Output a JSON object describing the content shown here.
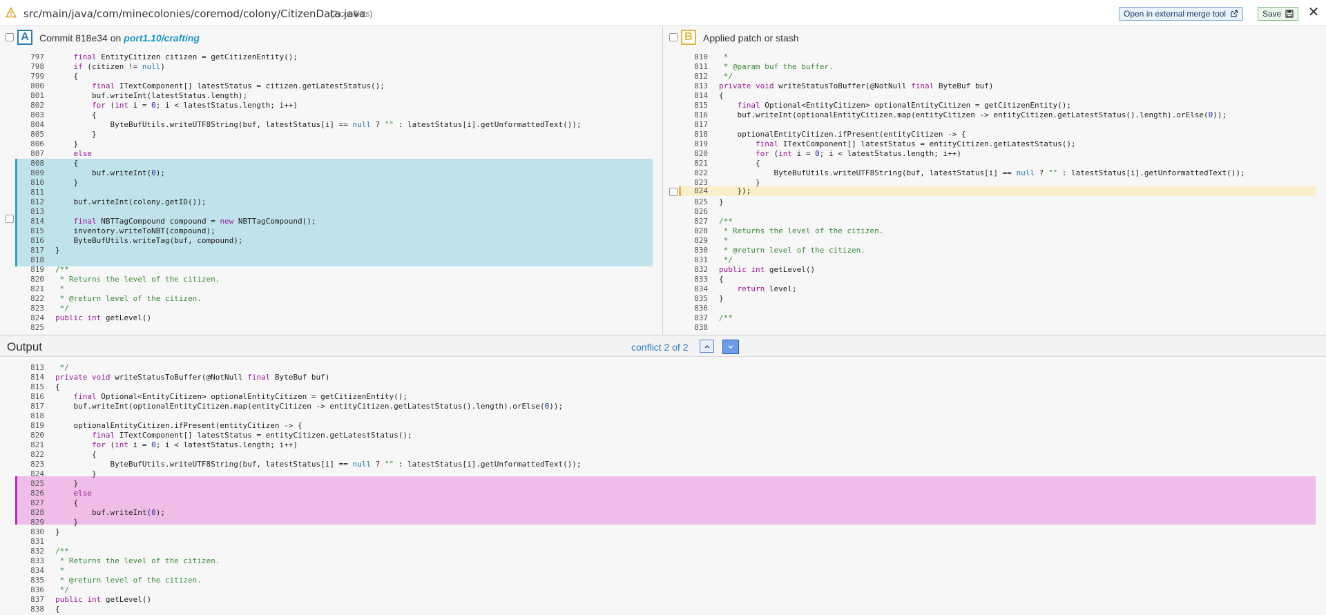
{
  "topbar": {
    "file_path": "src/main/java/com/minecolonies/coremod/colony/CitizenData.java",
    "conflicts_label": "(2 conflicts)",
    "external_tool_label": "Open in external merge tool",
    "save_label": "Save"
  },
  "pane_a": {
    "badge": "A",
    "title": "Commit 818e34 on",
    "branch": "port1.10/crafting"
  },
  "pane_b": {
    "badge": "B",
    "title": "Applied patch or stash"
  },
  "output": {
    "title": "Output",
    "conflict_nav": "conflict 2 of 2"
  },
  "colors": {
    "ours_highlight": "#c0e2ea",
    "theirs_highlight": "#fbeecb",
    "output_highlight": "#efbde8"
  }
}
